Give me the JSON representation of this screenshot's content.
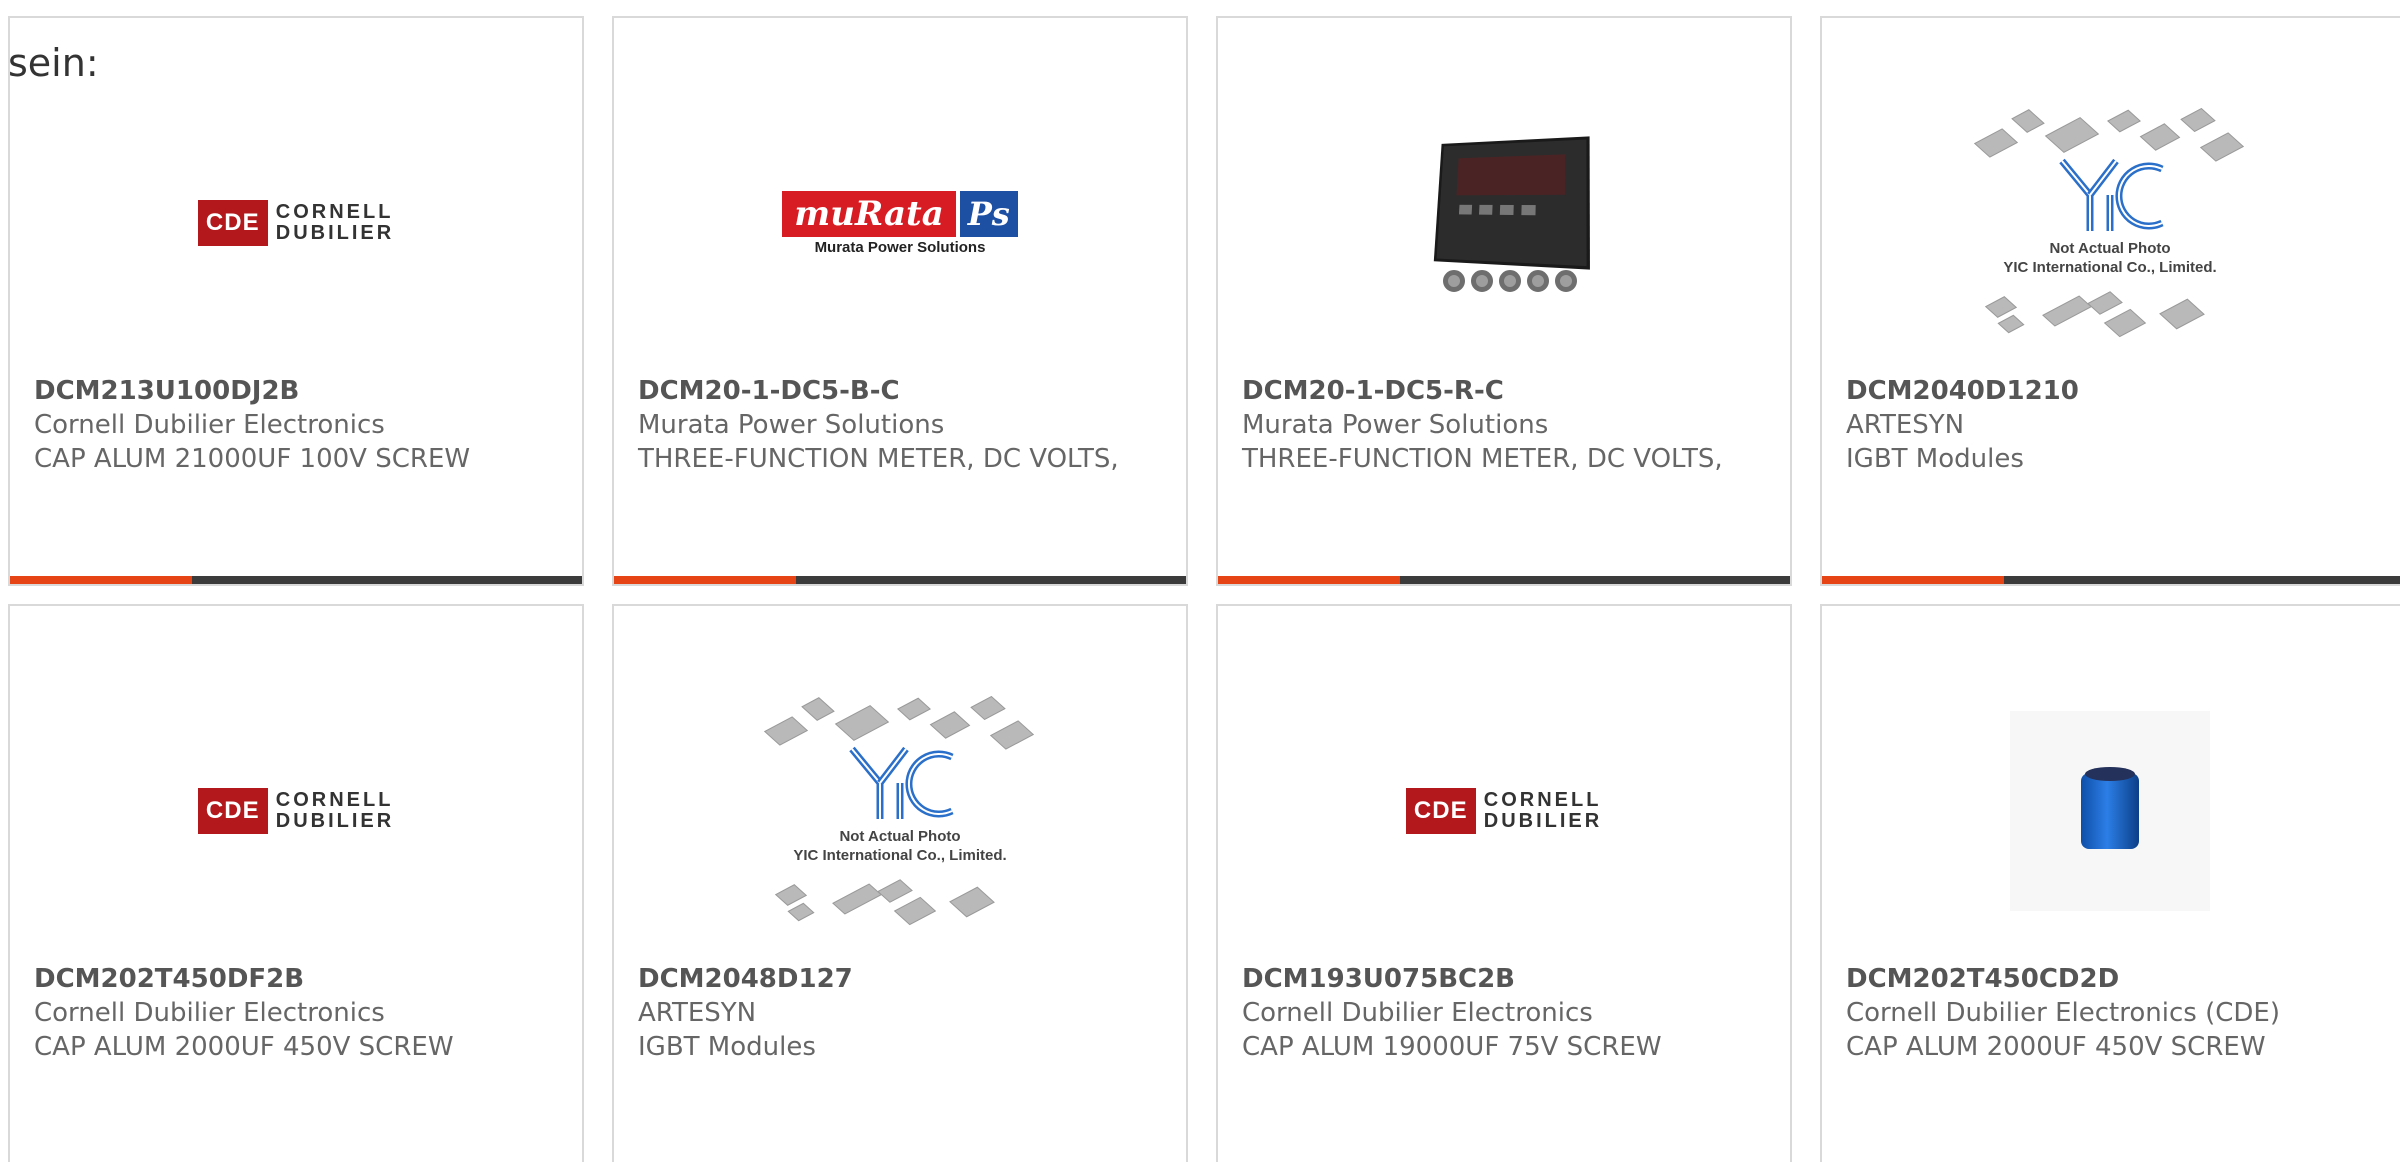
{
  "intro_text": "sein:",
  "colors": {
    "accent": "#e64414",
    "bar": "#3b3b3b",
    "border": "#d9d9d9"
  },
  "cards": [
    {
      "part_number": "DCM213U100DJ2B",
      "manufacturer": "Cornell Dubilier Electronics",
      "description": "CAP ALUM 21000UF 100V SCREW",
      "image": "cornell-dubilier-logo",
      "logo_text": {
        "badge": "CDE",
        "line1": "CORNELL",
        "line2": "DUBILIER"
      }
    },
    {
      "part_number": "DCM20-1-DC5-B-C",
      "manufacturer": "Murata Power Solutions",
      "description": "THREE-FUNCTION METER, DC VOLTS,",
      "image": "murata-logo",
      "logo_text": {
        "name": "muRata",
        "badge": "Ps",
        "sub": "Murata Power Solutions"
      }
    },
    {
      "part_number": "DCM20-1-DC5-R-C",
      "manufacturer": "Murata Power Solutions",
      "description": "THREE-FUNCTION METER, DC VOLTS,",
      "image": "power-meter-photo"
    },
    {
      "part_number": "DCM2040D1210",
      "manufacturer": "ARTESYN",
      "description": "IGBT Modules",
      "image": "yic-placeholder",
      "logo_text": {
        "line1": "Not Actual Photo",
        "line2": "YIC International Co., Limited."
      }
    },
    {
      "part_number": "DCM202T450DF2B",
      "manufacturer": "Cornell Dubilier Electronics",
      "description": "CAP ALUM 2000UF 450V SCREW",
      "image": "cornell-dubilier-logo",
      "logo_text": {
        "badge": "CDE",
        "line1": "CORNELL",
        "line2": "DUBILIER"
      }
    },
    {
      "part_number": "DCM2048D127",
      "manufacturer": "ARTESYN",
      "description": "IGBT Modules",
      "image": "yic-placeholder",
      "logo_text": {
        "line1": "Not Actual Photo",
        "line2": "YIC International Co., Limited."
      }
    },
    {
      "part_number": "DCM193U075BC2B",
      "manufacturer": "Cornell Dubilier Electronics",
      "description": "CAP ALUM 19000UF 75V SCREW",
      "image": "cornell-dubilier-logo",
      "logo_text": {
        "badge": "CDE",
        "line1": "CORNELL",
        "line2": "DUBILIER"
      }
    },
    {
      "part_number": "DCM202T450CD2D",
      "manufacturer": "Cornell Dubilier Electronics (CDE)",
      "description": "CAP ALUM 2000UF 450V SCREW",
      "image": "capacitor-photo"
    }
  ]
}
